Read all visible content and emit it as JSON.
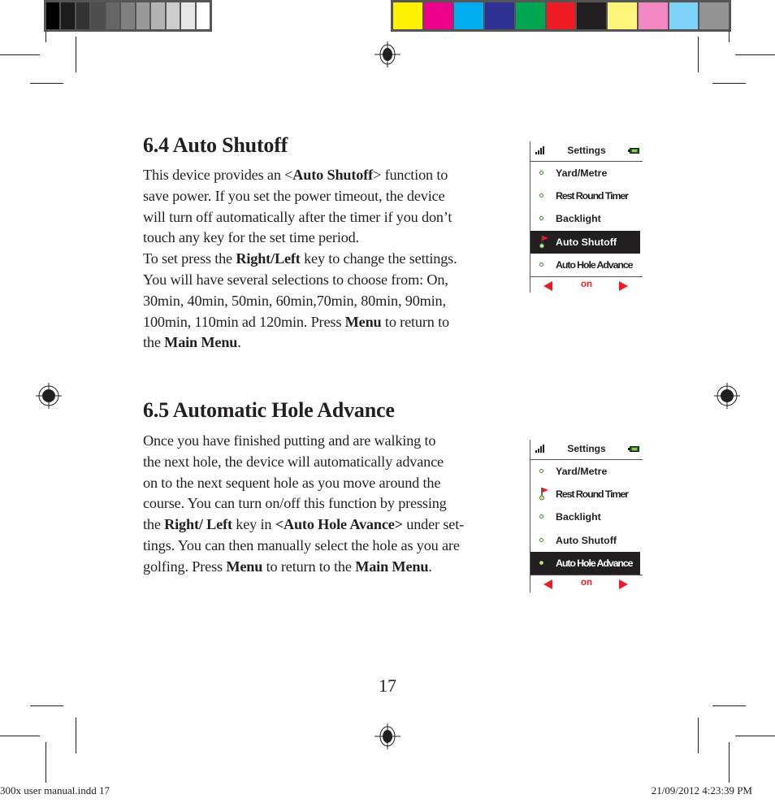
{
  "color_bars": {
    "grayscale": [
      "#000000",
      "#1c1c1c",
      "#333333",
      "#4d4d4d",
      "#666666",
      "#808080",
      "#999999",
      "#b3b3b3",
      "#cccccc",
      "#e6e6e6",
      "#ffffff"
    ],
    "process": [
      "#fff200",
      "#ec008c",
      "#00aeef",
      "#2e3192",
      "#00a651",
      "#ed1c24",
      "#231f20",
      "#fff57d",
      "#f287c4",
      "#7dd3f7",
      "#939393"
    ]
  },
  "section_64": {
    "heading": "6.4 Auto Shutoff",
    "lines": [
      [
        {
          "t": "This device provides an <"
        },
        {
          "t": "Auto Shutoff",
          "b": true
        },
        {
          "t": "> function to"
        }
      ],
      [
        {
          "t": "save power. If you set the power timeout, the device"
        }
      ],
      [
        {
          "t": "will turn off automatically after the timer if you don’t"
        }
      ],
      [
        {
          "t": "touch any key for the set time period."
        }
      ],
      [
        {
          "t": "To set press the "
        },
        {
          "t": "Right/Left",
          "b": true
        },
        {
          "t": " key to change the settings."
        }
      ],
      [
        {
          "t": "You will have several selections to choose from: On,"
        }
      ],
      [
        {
          "t": "30min, 40min, 50min, 60min,70min, 80min, 90min,"
        }
      ],
      [
        {
          "t": "100min, 110min ad 120min. Press "
        },
        {
          "t": "Menu",
          "b": true
        },
        {
          "t": " to return to"
        }
      ],
      [
        {
          "t": "the "
        },
        {
          "t": "Main Menu",
          "b": true
        },
        {
          "t": "."
        }
      ]
    ],
    "screen": {
      "title": "Settings",
      "icons": {
        "signal": "signal-bars-icon",
        "battery": "battery-icon"
      },
      "items": [
        {
          "label": "Yard/Metre",
          "marker": "dot",
          "selected": false,
          "condensed": false
        },
        {
          "label": "Rest Round Timer",
          "marker": "dot",
          "selected": false,
          "condensed": true
        },
        {
          "label": "Backlight",
          "marker": "dot",
          "selected": false,
          "condensed": false
        },
        {
          "label": "Auto Shutoff",
          "marker": "flag",
          "selected": true,
          "condensed": false
        },
        {
          "label": "Auto Hole Advance",
          "marker": "dot",
          "selected": false,
          "condensed": true
        }
      ],
      "value": "on"
    }
  },
  "section_65": {
    "heading": "6.5 Automatic Hole Advance",
    "lines": [
      [
        {
          "t": "Once you have finished putting and are walking to"
        }
      ],
      [
        {
          "t": "the next hole, the device will automatically advance"
        }
      ],
      [
        {
          "t": "on to the next sequent hole as you move around the"
        }
      ],
      [
        {
          "t": "course. You can turn on/off this function by pressing"
        }
      ],
      [
        {
          "t": "the "
        },
        {
          "t": "Right/ Left",
          "b": true
        },
        {
          "t": " key in "
        },
        {
          "t": "<Auto Hole Avance>",
          "b": true
        },
        {
          "t": " under set-"
        }
      ],
      [
        {
          "t": "tings. You can then manually select the hole as you are"
        }
      ],
      [
        {
          "t": "golfing. Press "
        },
        {
          "t": "Menu",
          "b": true
        },
        {
          "t": " to return to the "
        },
        {
          "t": "Main Menu",
          "b": true
        },
        {
          "t": "."
        }
      ]
    ],
    "screen": {
      "title": "Settings",
      "icons": {
        "signal": "signal-bars-icon",
        "battery": "battery-icon"
      },
      "items": [
        {
          "label": "Yard/Metre",
          "marker": "dot",
          "selected": false,
          "condensed": false
        },
        {
          "label": "Rest Round Timer",
          "marker": "flag",
          "selected": false,
          "condensed": true
        },
        {
          "label": "Backlight",
          "marker": "dot",
          "selected": false,
          "condensed": false
        },
        {
          "label": "Auto Shutoff",
          "marker": "dot",
          "selected": false,
          "condensed": false
        },
        {
          "label": "Auto Hole Advance",
          "marker": "dot",
          "selected": true,
          "condensed": true
        }
      ],
      "value": "on"
    }
  },
  "footer": {
    "page_number": "17",
    "slug_left": "300x user manual.indd   17",
    "slug_right": "21/09/2012   4:23:39 PM"
  },
  "colors": {
    "text": "#231f20",
    "accent_red": "#ed1c24",
    "marker_green": "#3c8c2c"
  }
}
